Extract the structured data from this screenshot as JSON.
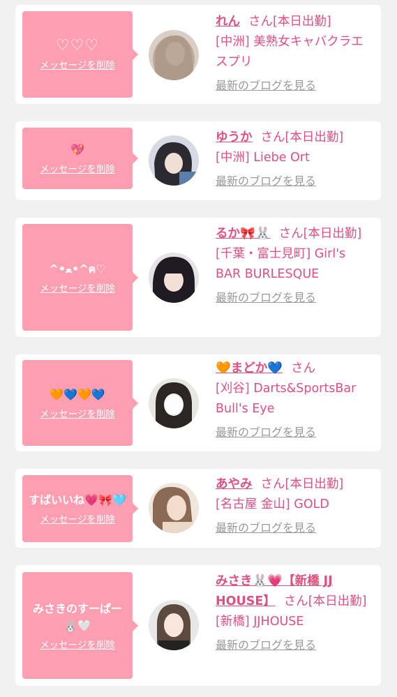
{
  "delete_label": "メッセージを削除",
  "blog_label": "最新のブログを見る",
  "cards": [
    {
      "message": "♡♡♡",
      "name": "れん",
      "suffix": "さん[本日出勤]",
      "shop": "[中洲] 美熟女キャバクラエスプリ"
    },
    {
      "message": "💖",
      "name": "ゆうか",
      "suffix": "さん[本日出勤]",
      "shop": "[中洲] Liebe Ort"
    },
    {
      "message": "^•﻿ﻌ•^ฅ♡",
      "name": "るか🎀🐰",
      "suffix": "さん[本日出勤]",
      "shop": "[千葉・富士見町] Girl's BAR BURLESQUE"
    },
    {
      "message": "🧡💙🧡💙",
      "name": "🧡まどか💙",
      "suffix": "さん",
      "shop": "[刈谷] Darts&SportsBar Bull's Eye"
    },
    {
      "message": "すばいいね💗🎀🩵",
      "name": "あやみ",
      "suffix": "さん[本日出勤]",
      "shop": "[名古屋 金山] GOLD"
    },
    {
      "message": "みさきのすーぱー🐰🤍",
      "name": "みさき🐰💗【新橋 JJ HOUSE】",
      "suffix": "さん[本日出勤]",
      "shop": "[新橋] JJHOUSE"
    }
  ],
  "colors": {
    "accent": "#e0507e",
    "bubble": "#ff9eb0",
    "muted": "#999999"
  }
}
